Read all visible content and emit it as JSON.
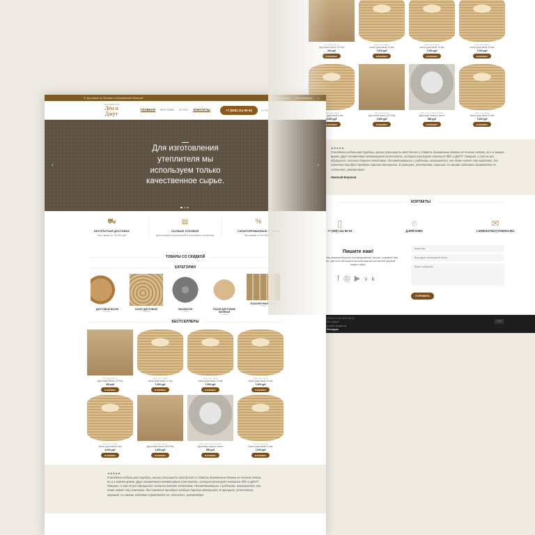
{
  "topbar": {
    "delivery": "✈ Доставка по Москве и Московской области!",
    "track": "Отследить заказ",
    "login": "Авторизация"
  },
  "header": {
    "logo": "Лён и Джут",
    "logo_tag": "ТОРГОВЫЙ ДОМ",
    "nav": [
      "ГЛАВНАЯ",
      "МАГАЗИН",
      "О НАС",
      "КОНТАКТЫ"
    ],
    "phone": "+7 (926) 114 96 64",
    "cart": "0 РУБ"
  },
  "hero": {
    "title": "Для изготовления утеплителя мы используем только качественное сырье."
  },
  "features": [
    {
      "title": "БЕСПЛАТНАЯ ДОСТАВКА",
      "text": "При заказе от 25,000 руб"
    },
    {
      "title": "ОСОБЫЕ УСЛОВИЯ",
      "text": "Для оптовых покупателей и постоянных клиентов"
    },
    {
      "title": "ГАРАНТИРОВАННЫЕ СКИДКИ",
      "text": "При заказе от 50,000 руб"
    }
  ],
  "sections": {
    "sale": "ТОВАРЫ СО СКИДКОЙ",
    "categories": "КАТЕГОРИИ",
    "best": "БЕСТСЕЛЛЕРЫ",
    "contacts": "КОНТАКТЫ"
  },
  "categories": [
    {
      "name": "ДЖУТОВЫЙ ВАТИН",
      "count": "2 Товара"
    },
    {
      "name": "КАНАТ ДЖУТОВЫЙ",
      "count": "6 Товаров"
    },
    {
      "name": "ЛЬНОВАТИН",
      "count": "1 Товар"
    },
    {
      "name": "ПАКЛЯ ДЖУТОВАЯ/ ЛЬНЯНАЯ",
      "count": "4 Товара"
    },
    {
      "name": "УПАКОВОЧНАЯ ТКАНЬ",
      "count": "1 Товар"
    }
  ],
  "products": [
    {
      "cat": "джутовый ватин",
      "name": "Джутовый ватин 10*20м",
      "price": "220 руб"
    },
    {
      "cat": "канат джутовый",
      "name": "Канат джутовый 12 мм",
      "price": "7,000 руб"
    },
    {
      "cat": "канат джутовый",
      "name": "Канат джутовый 10 мм",
      "price": "7,000 руб"
    },
    {
      "cat": "канат джутовый",
      "name": "Канат джутовый 16 мм",
      "price": "7,000 руб"
    },
    {
      "cat": "канат джутовый",
      "name": "Канат джутовый 6 мм",
      "price": "8,000 руб"
    },
    {
      "cat": "джутовый ватин",
      "name": "Джутовый ватин 100*20м",
      "price": "1,800 руб"
    },
    {
      "cat": "пакля джутовая/льняная",
      "name": "Джутовая пакля в ленте",
      "price": "850 руб"
    },
    {
      "cat": "канат джутовый",
      "name": "Канат джутовый 24 мм",
      "price": "7,000 руб"
    }
  ],
  "cart_button": "В КОРЗИНУ",
  "testimonial": {
    "stars": "★★★★★",
    "text": "Я владелец небольшой турбазы, решил расширить свой бизнес и сдавать деревянные домики не только летом, но и в зимнее время. Друг посоветовал межвенцовый утеплитель, который реализует компания ЛЁН и ДЖУТ. Говорит, и сам не раз обращался, остался доволен качеством. Посоветовавшись с рабочими, оказывается, они тоже знают эту компанию, без сомнения приобрел пробную партию материала. В принципе, утеплитель хороший, со своими задачами справляется на «отлично», рекомендую!",
    "author": "Николай Воронов"
  },
  "contacts": {
    "phone": "+7 (926) 114 96 64",
    "address": "Д.БРЁХОВО",
    "email": "LIONDJUT83@YANDEX.RU"
  },
  "form": {
    "title": "Пишите нам!",
    "text": "Если у Вас возникли вопросы или предложения, пишите, отправьте нам письмо. Для этого Вы можете воспользоваться контактной формой нашего сайта.",
    "name_ph": "Ваше имя",
    "email_ph": "Ваш адрес электронной почты",
    "msg_ph": "Ваше сообщение",
    "submit": "ОТПРАВИТЬ"
  },
  "footer": {
    "links": "МАГАЗИН  О НАС  КОНТАКТЫ",
    "brand": "© Лён и Джут»",
    "rights": "Все права защищены.",
    "author": "A. Gevorgyan",
    "year": "2018"
  },
  "colors": {
    "brand": "#7a4e16",
    "topbar": "#7b5a25",
    "testimonial_bg": "#f2ede3",
    "footer": "#1d1d1d"
  }
}
